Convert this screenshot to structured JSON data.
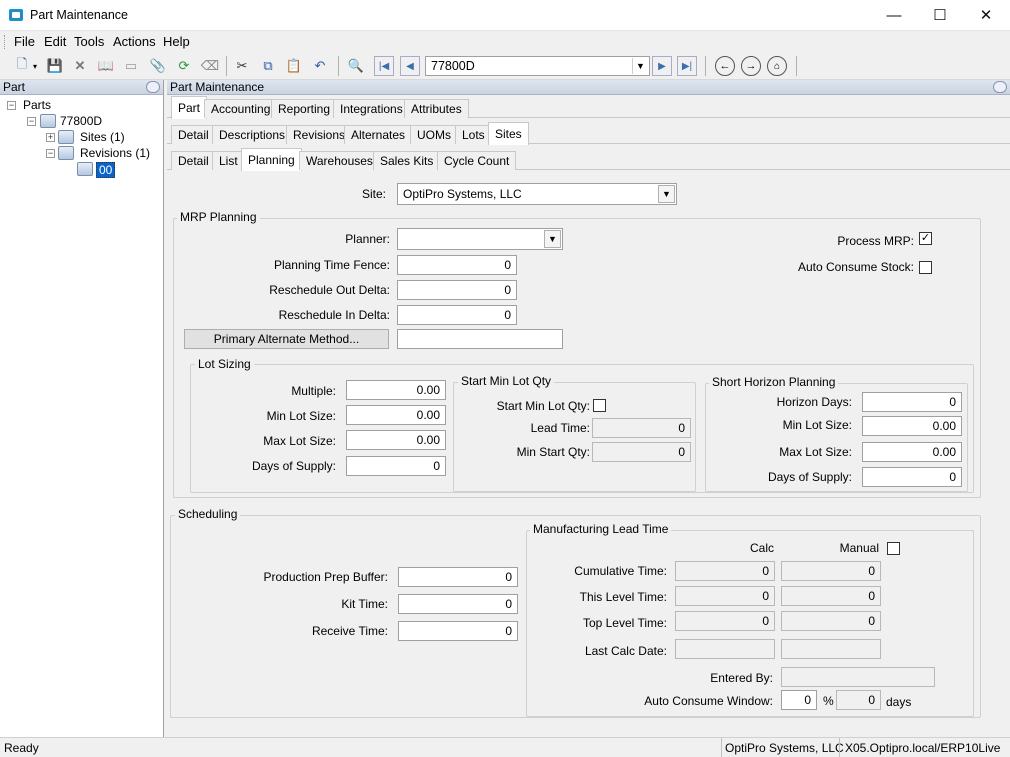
{
  "window": {
    "title": "Part Maintenance",
    "minimize": "—",
    "maximize": "☐",
    "close": "✕"
  },
  "menu": [
    "File",
    "Edit",
    "Tools",
    "Actions",
    "Help"
  ],
  "toolbar": {
    "part_value": "77800D"
  },
  "left": {
    "header": "Part",
    "tree": {
      "root": "Parts",
      "part": "77800D",
      "sites": "Sites (1)",
      "revisions": "Revisions (1)",
      "rev": "00"
    }
  },
  "right": {
    "header": "Part Maintenance",
    "tabs1": [
      "Part",
      "Accounting",
      "Reporting",
      "Integrations",
      "Attributes"
    ],
    "tabs2": [
      "Detail",
      "Descriptions",
      "Revisions",
      "Alternates",
      "UOMs",
      "Lots",
      "Sites"
    ],
    "tabs3": [
      "Detail",
      "List",
      "Planning",
      "Warehouses",
      "Sales Kits",
      "Cycle Count"
    ]
  },
  "site": {
    "label": "Site:",
    "value": "OptiPro Systems, LLC"
  },
  "mrp": {
    "group": "MRP Planning",
    "planner_label": "Planner:",
    "planner_value": "",
    "fence_label": "Planning Time Fence:",
    "fence": "0",
    "out_label": "Reschedule Out Delta:",
    "out": "0",
    "in_label": "Reschedule In Delta:",
    "in": "0",
    "alt_button": "Primary Alternate Method...",
    "alt_value": "",
    "process_label": "Process MRP:",
    "process_checked": "✓",
    "auto_label": "Auto Consume Stock:",
    "auto_checked": ""
  },
  "lot": {
    "group": "Lot Sizing",
    "multiple_label": "Multiple:",
    "multiple": "0.00",
    "min_label": "Min Lot Size:",
    "min": "0.00",
    "max_label": "Max Lot Size:",
    "max": "0.00",
    "days_label": "Days of Supply:",
    "days": "0"
  },
  "startmin": {
    "group": "Start Min Lot Qty",
    "qty_label": "Start Min Lot Qty:",
    "lead_label": "Lead Time:",
    "lead": "0",
    "minstart_label": "Min Start Qty:",
    "minstart": "0"
  },
  "short": {
    "group": "Short Horizon Planning",
    "horizon_label": "Horizon Days:",
    "horizon": "0",
    "min_label": "Min Lot Size:",
    "min": "0.00",
    "max_label": "Max Lot Size:",
    "max": "0.00",
    "days_label": "Days of Supply:",
    "days": "0"
  },
  "sched": {
    "group": "Scheduling",
    "prep_label": "Production Prep Buffer:",
    "prep": "0",
    "kit_label": "Kit Time:",
    "kit": "0",
    "receive_label": "Receive Time:",
    "receive": "0"
  },
  "mfg": {
    "group": "Manufacturing Lead Time",
    "calc_hdr": "Calc",
    "manual_hdr": "Manual",
    "cum_label": "Cumulative Time:",
    "cum_calc": "0",
    "cum_man": "0",
    "this_label": "This Level Time:",
    "this_calc": "0",
    "this_man": "0",
    "top_label": "Top Level Time:",
    "top_calc": "0",
    "top_man": "0",
    "last_label": "Last Calc Date:",
    "last_calc": "",
    "last_man": "",
    "entered_label": "Entered By:",
    "entered": "",
    "window_label": "Auto Consume Window:",
    "window_pct": "0",
    "pct": "%",
    "window_days": "0",
    "days": "days"
  },
  "status": {
    "left": "Ready",
    "company": "OptiPro Systems, LLC",
    "server": "X05.Optipro.local/ERP10Live"
  }
}
